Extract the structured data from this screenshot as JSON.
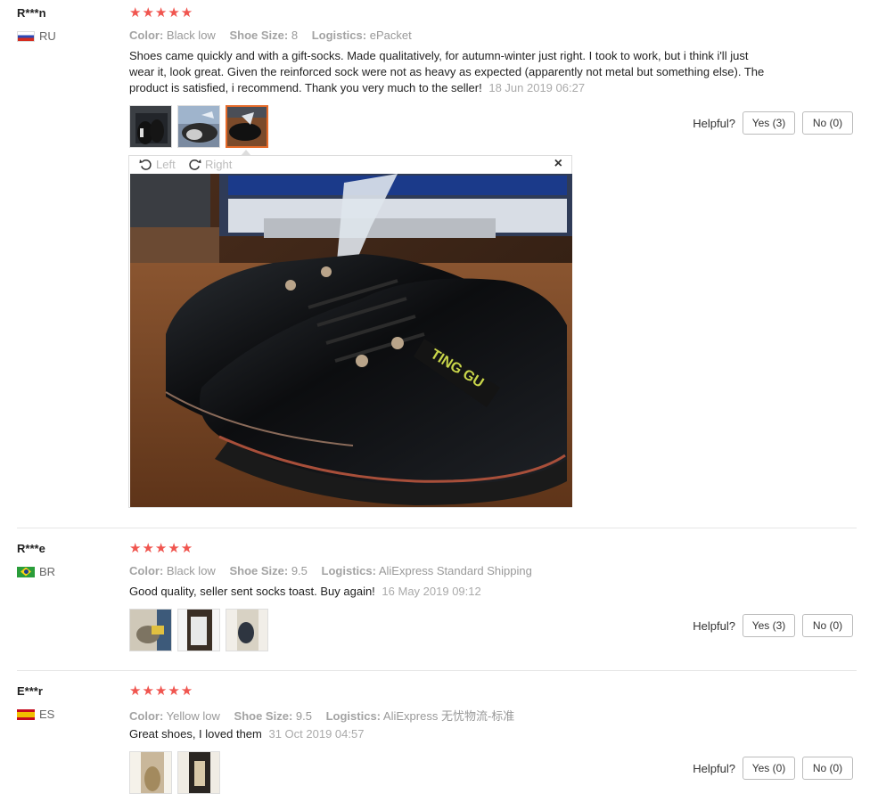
{
  "helpful_label": "Helpful?",
  "viewer": {
    "left_label": "Left",
    "right_label": "Right",
    "close_label": "×"
  },
  "reviews": [
    {
      "user": "R***n",
      "country": "RU",
      "stars": "★★★★★",
      "color_label": "Color:",
      "color_value": "Black low",
      "size_label": "Shoe Size:",
      "size_value": "8",
      "logistics_label": "Logistics:",
      "logistics_value": "ePacket",
      "text": "Shoes came quickly and with a gift-socks. Made qualitatively, for autumn-winter just right. I took to work, but i think i'll just wear it, look great. Given the reinforced sock were not as heavy as expected (apparently not metal but something else). The product is satisfied, i recommend. Thank you very much to the seller!",
      "date": "18 Jun 2019 06:27",
      "yes": "Yes (3)",
      "no": "No (0)"
    },
    {
      "user": "R***e",
      "country": "BR",
      "stars": "★★★★★",
      "color_label": "Color:",
      "color_value": "Black low",
      "size_label": "Shoe Size:",
      "size_value": "9.5",
      "logistics_label": "Logistics:",
      "logistics_value": "AliExpress Standard Shipping",
      "text": "Good quality, seller sent socks toast. Buy again!",
      "date": "16 May 2019 09:12",
      "yes": "Yes (3)",
      "no": "No (0)"
    },
    {
      "user": "E***r",
      "country": "ES",
      "stars": "★★★★★",
      "color_label": "Color:",
      "color_value": "Yellow low",
      "size_label": "Shoe Size:",
      "size_value": "9.5",
      "logistics_label": "Logistics:",
      "logistics_value": "AliExpress 无忧物流-标准",
      "text": "Great shoes, I loved them",
      "date": "31 Oct 2019 04:57",
      "yes": "Yes (0)",
      "no": "No (0)"
    }
  ]
}
